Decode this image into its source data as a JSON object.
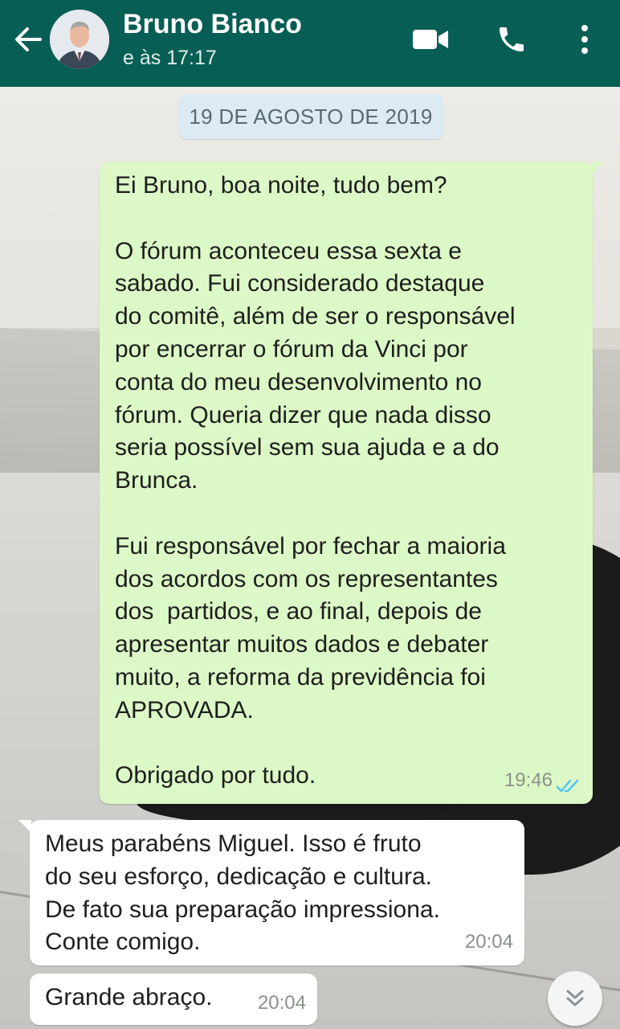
{
  "header": {
    "contact_name": "Bruno Bianco",
    "status": "e às 17:17",
    "color": "#075e54",
    "icons": [
      "back-arrow-icon",
      "video-call-icon",
      "phone-icon",
      "more-vertical-icon"
    ]
  },
  "date_chip": "19 DE AGOSTO DE 2019",
  "messages": [
    {
      "direction": "outgoing",
      "lines": [
        "Ei Bruno, boa noite, tudo bem?",
        "",
        "O fórum aconteceu essa sexta e",
        "sabado. Fui considerado destaque",
        "do comitê, além de ser o responsável",
        "por encerrar o fórum da Vinci por",
        "conta do meu desenvolvimento no",
        "fórum. Queria dizer que nada disso",
        "seria possível sem sua ajuda e a do",
        "Brunca.",
        "",
        "Fui responsável por fechar a maioria",
        "dos acordos com os representantes",
        "dos  partidos, e ao final, depois de",
        "apresentar muitos dados e debater",
        "muito, a reforma da previdência foi",
        "APROVADA.",
        "",
        "Obrigado por tudo."
      ],
      "time": "19:46",
      "status_icon": "double-check-read-icon"
    },
    {
      "direction": "incoming",
      "lines": [
        "Meus parabéns Miguel. Isso é fruto",
        "do seu esforço, dedicação e cultura.",
        "De fato sua preparação impressiona.",
        "Conte comigo."
      ],
      "time": "20:04"
    },
    {
      "direction": "incoming",
      "lines": [
        "Grande abraço."
      ],
      "time": "20:04"
    }
  ],
  "colors": {
    "outgoing_bubble": "#dcf8c6",
    "incoming_bubble": "#ffffff",
    "read_ticks": "#4fc3f7"
  }
}
